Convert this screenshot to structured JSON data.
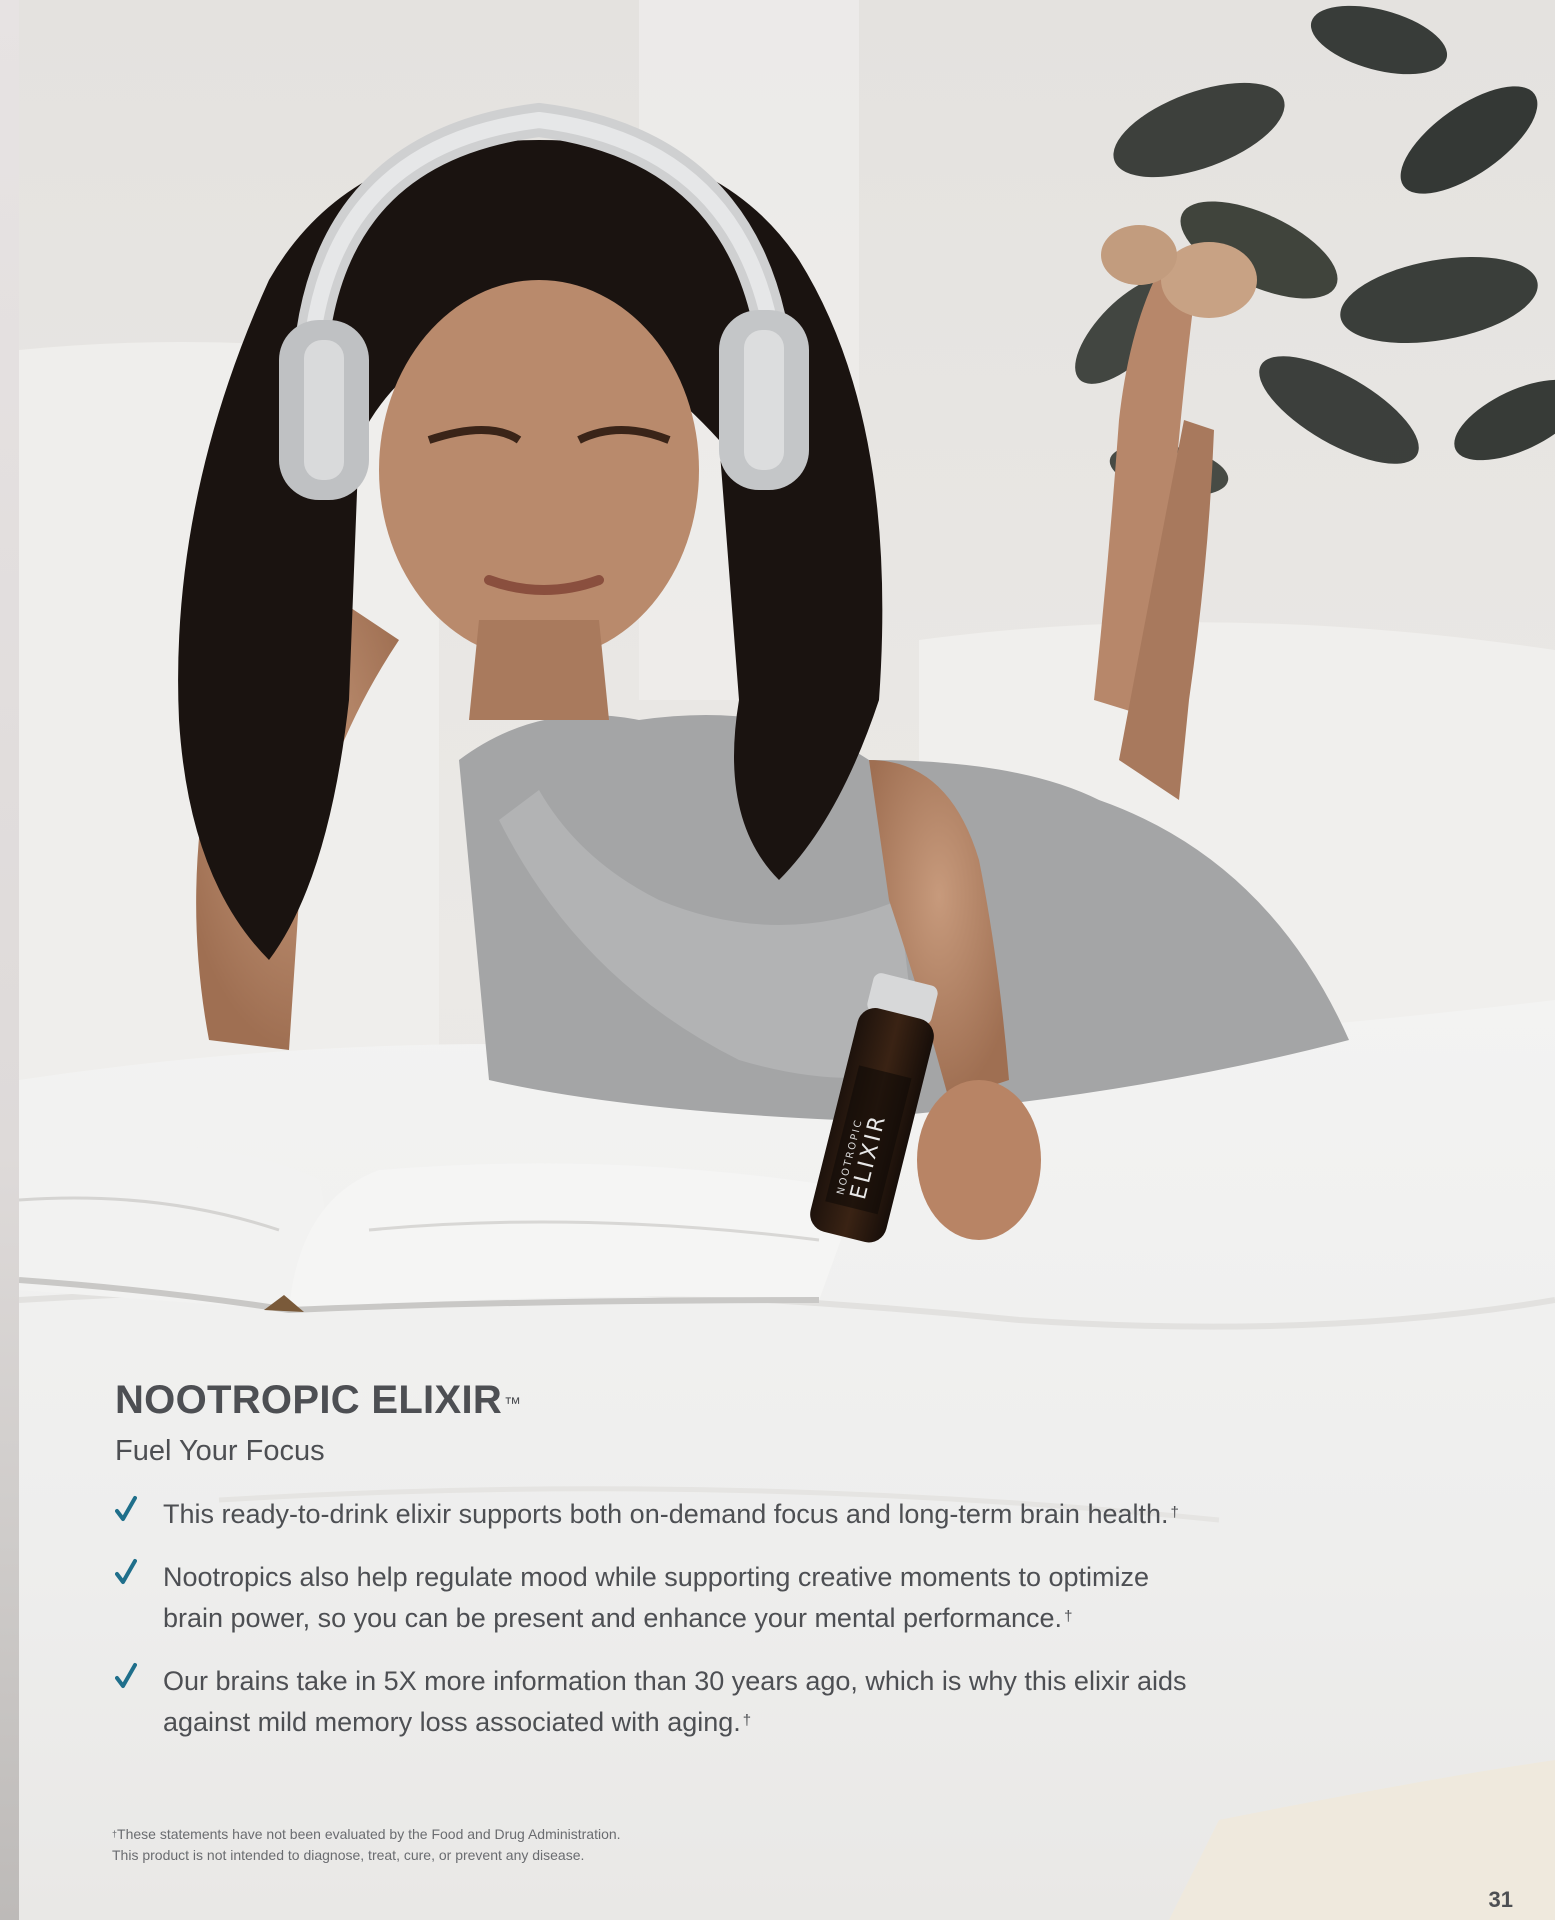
{
  "product": {
    "title": "NOOTROPIC ELIXIR",
    "trademark": "™",
    "subtitle": "Fuel Your Focus"
  },
  "bottle_label": {
    "line1": "NOOTROPIC",
    "line2": "ELIXIR"
  },
  "bullets": [
    {
      "lines": [
        "This ready-to-drink elixir supports both on-demand focus and long-term brain health."
      ],
      "mark": "†"
    },
    {
      "lines": [
        "Nootropics also help regulate mood while supporting creative moments to optimize",
        "brain power, so you can be present and enhance your mental performance."
      ],
      "mark": "†"
    },
    {
      "lines": [
        "Our brains take in 5X more information than 30 years ago, which is why this elixir aids",
        "against mild memory loss associated with aging."
      ],
      "mark": "†"
    }
  ],
  "footnote": {
    "mark": "†",
    "line1": "These statements have not been evaluated by the Food and Drug Administration.",
    "line2": "This product is not intended to diagnose, treat, cure, or prevent any disease."
  },
  "page_number": "31",
  "colors": {
    "text": "#4d4f53",
    "check": "#1f6f8b"
  }
}
